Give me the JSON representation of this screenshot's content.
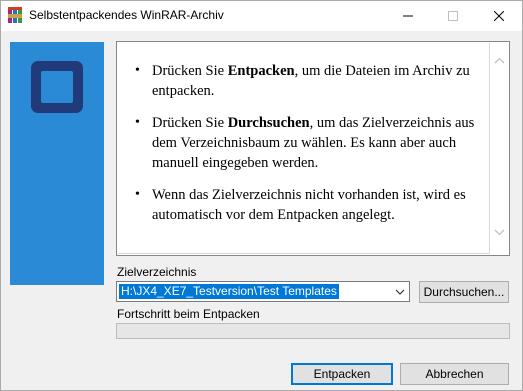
{
  "window": {
    "title": "Selbstentpackendes WinRAR-Archiv",
    "icons": {
      "app": "winrar-books-icon",
      "minimize": "minimize-icon",
      "maximize": "maximize-icon",
      "close": "close-icon"
    }
  },
  "info": {
    "bullets": [
      {
        "before": "Drücken Sie ",
        "bold": "Entpacken",
        "after": ", um die Dateien im Archiv zu entpacken."
      },
      {
        "before": "Drücken Sie ",
        "bold": "Durchsuchen",
        "after": ", um das Zielverzeichnis aus dem Verzeichnisbaum zu wählen. Es kann aber auch manuell eingegeben werden."
      },
      {
        "before": "",
        "bold": "",
        "after": "Wenn das Zielverzeichnis nicht vorhanden ist, wird es automatisch vor dem Entpacken angelegt."
      }
    ]
  },
  "destination": {
    "label": "Zielverzeichnis",
    "value": "H:\\JX4_XE7_Testversion\\Test Templates",
    "browse_label": "Durchsuchen..."
  },
  "progress": {
    "label": "Fortschritt beim Entpacken",
    "value": 0
  },
  "footer": {
    "extract_label": "Entpacken",
    "cancel_label": "Abbrechen"
  },
  "colors": {
    "sidebar": "#2a8ad6",
    "logo": "#203a7a",
    "selection": "#0078d7",
    "default_button_border": "#0078d7"
  }
}
